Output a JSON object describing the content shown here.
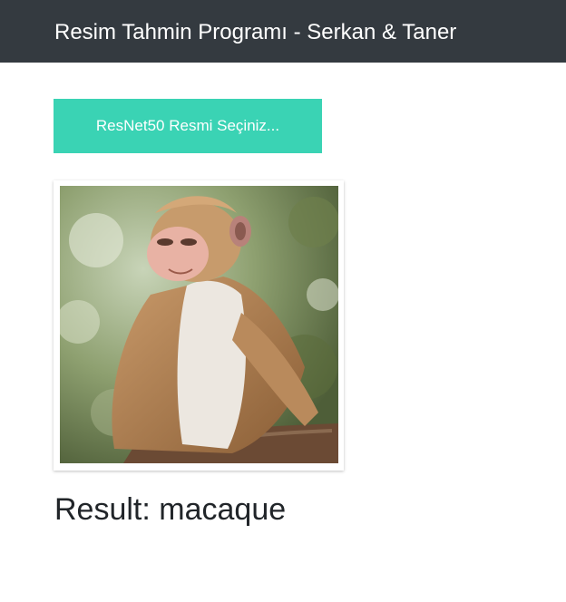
{
  "header": {
    "title": "Resim Tahmin Programı - Serkan & Taner"
  },
  "upload": {
    "button_label": "ResNet50 Resmi Seçiniz..."
  },
  "preview": {
    "image_subject": "macaque monkey photo"
  },
  "result": {
    "text": "Result: macaque"
  },
  "colors": {
    "navbar": "#343a40",
    "button": "#3ad3b4",
    "result_text": "#212529"
  }
}
